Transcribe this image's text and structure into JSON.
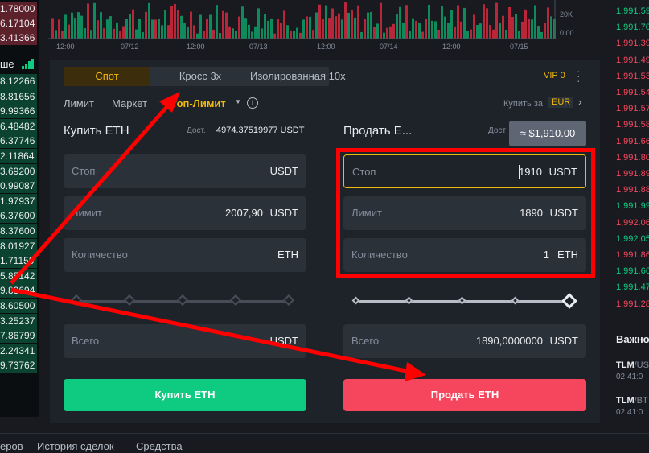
{
  "orderbook_left": {
    "heading": "ше",
    "values": [
      "1.78000",
      "6.17104",
      "3.41366",
      "8.12266",
      "8.81656",
      "9.99366",
      "6.48482",
      "6.37746",
      "2.11864",
      "3.69200",
      "0.99087",
      "1.97937",
      "6.37600",
      "8.37600",
      "8.01927",
      "1.71159",
      "5.85142",
      "9.83694",
      "8.60500",
      "3.25237",
      "7.86799",
      "2.24341",
      "9.73762"
    ]
  },
  "chart": {
    "vol_ticks": [
      "20K",
      "0.00"
    ],
    "x_ticks": [
      "12:00",
      "07/12",
      "12:00",
      "07/13",
      "12:00",
      "07/14",
      "12:00",
      "07/15"
    ]
  },
  "right_prices": [
    {
      "v": "1,991.59",
      "c": "g"
    },
    {
      "v": "1,991.70",
      "c": "g"
    },
    {
      "v": "1,991.39",
      "c": "r"
    },
    {
      "v": "1,991.49",
      "c": "r"
    },
    {
      "v": "1,991.53",
      "c": "r"
    },
    {
      "v": "1,991.54",
      "c": "r"
    },
    {
      "v": "1,991.57",
      "c": "r"
    },
    {
      "v": "1,991.58",
      "c": "r"
    },
    {
      "v": "1,991.66",
      "c": "r"
    },
    {
      "v": "1,991.80",
      "c": "r"
    },
    {
      "v": "1,991.89",
      "c": "r"
    },
    {
      "v": "1,991.88",
      "c": "r"
    },
    {
      "v": "1,991.99",
      "c": "g"
    },
    {
      "v": "1,992.06",
      "c": "r"
    },
    {
      "v": "1,992.05",
      "c": "g"
    },
    {
      "v": "1,991.86",
      "c": "r"
    },
    {
      "v": "1,991.66",
      "c": "g"
    },
    {
      "v": "1,991.47",
      "c": "g"
    },
    {
      "v": "1,991.28",
      "c": "r"
    }
  ],
  "news": {
    "title": "Важно",
    "items": [
      {
        "pair": "TLM",
        "quote": "/US",
        "time": "02:41:0"
      },
      {
        "pair": "TLM",
        "quote": "/BT",
        "time": "02:41:0"
      }
    ]
  },
  "panel": {
    "mode_tabs": [
      "Спот",
      "Кросс 3x",
      "Изолированная 10x"
    ],
    "vip": "VIP 0",
    "order_types": [
      "Лимит",
      "Маркет",
      "Стоп-Лимит"
    ],
    "buy_for_label": "Купить за",
    "buy_for_currency": "EUR",
    "buy": {
      "title": "Купить ETH",
      "avail_label": "Дост.",
      "avail_value": "4974.37519977 USDT",
      "stop_label": "Стоп",
      "stop_unit": "USDT",
      "limit_label": "Лимит",
      "limit_value": "2007,90",
      "limit_unit": "USDT",
      "qty_label": "Количество",
      "qty_unit": "ETH",
      "total_label": "Всего",
      "total_unit": "USDT",
      "button": "Купить ETH"
    },
    "sell": {
      "title": "Продать E...",
      "avail_label": "Дост",
      "stop_label": "Стоп",
      "stop_value": "1910",
      "stop_unit": "USDT",
      "limit_label": "Лимит",
      "limit_value": "1890",
      "limit_unit": "USDT",
      "qty_label": "Количество",
      "qty_value": "1",
      "qty_unit": "ETH",
      "total_label": "Всего",
      "total_value": "1890,0000000",
      "total_unit": "USDT",
      "button": "Продать ETH"
    },
    "tooltip": "≈ $1,910.00"
  },
  "bottom_tabs": [
    "еров",
    "История сделок",
    "Средства"
  ],
  "colors": {
    "accent": "#f0b90b",
    "buy": "#0ecb81",
    "sell": "#f6465d",
    "annotation": "#ff0000"
  }
}
